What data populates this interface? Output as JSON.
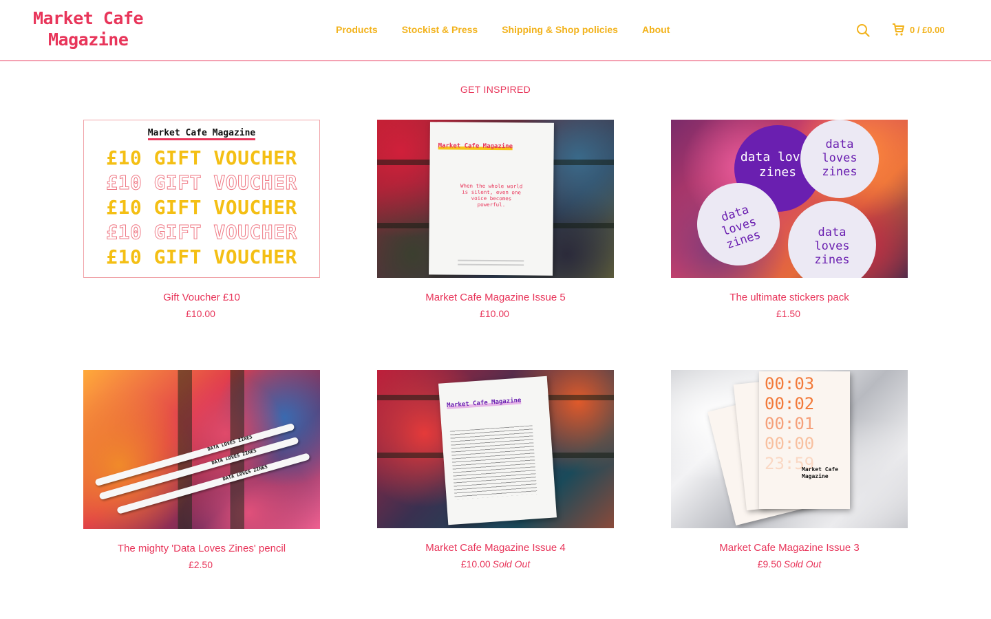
{
  "header": {
    "logo_line1": "Market Cafe",
    "logo_line2": "Magazine",
    "nav": [
      "Products",
      "Stockist & Press",
      "Shipping & Shop policies",
      "About"
    ],
    "search_icon": "search-icon",
    "cart_icon": "cart-icon",
    "cart_label": "0 / £0.00",
    "brand_color": "#e8355a",
    "accent_color": "#f2b21b"
  },
  "section_title": "GET INSPIRED",
  "voucher_art": {
    "title": "Market Cafe Magazine",
    "row": "£10 GIFT VOUCHER"
  },
  "issue5_art": {
    "title": "Market Cafe Magazine",
    "quote": "When the whole world is silent, even one voice becomes powerful."
  },
  "sticker_art": {
    "text": "data loves zines"
  },
  "pencil_art": {
    "label": "DATA LOVES ZINES"
  },
  "issue4_art": {
    "title": "Market Cafe Magazine"
  },
  "issue3_art": {
    "times": [
      "00:03",
      "00:02",
      "00:01",
      "00:00",
      "23:59"
    ],
    "title": "Market Cafe Magazine"
  },
  "products": [
    {
      "name": "Gift Voucher £10",
      "price": "£10.00",
      "status": ""
    },
    {
      "name": "Market Cafe Magazine Issue 5",
      "price": "£10.00",
      "status": ""
    },
    {
      "name": "The ultimate stickers pack",
      "price": "£1.50",
      "status": ""
    },
    {
      "name": "The mighty 'Data Loves Zines' pencil",
      "price": "£2.50",
      "status": ""
    },
    {
      "name": "Market Cafe Magazine Issue 4",
      "price": "£10.00",
      "status": "Sold Out"
    },
    {
      "name": "Market Cafe Magazine Issue 3",
      "price": "£9.50",
      "status": "Sold Out"
    }
  ]
}
